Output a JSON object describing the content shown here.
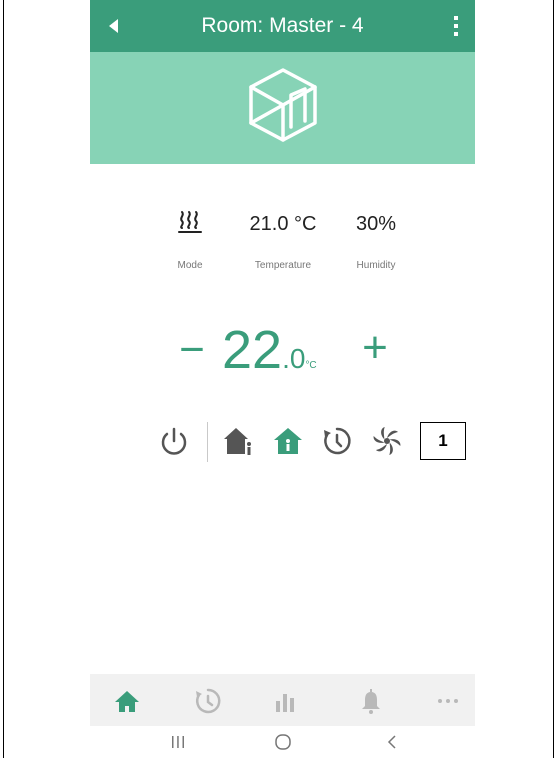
{
  "header": {
    "title": "Room: Master - 4",
    "back_icon": "back-arrow-icon",
    "menu_icon": "kebab-menu-icon",
    "background_color": "#3a9d7b"
  },
  "hero": {
    "icon": "room-icon",
    "background_color": "#87d3b6"
  },
  "status": {
    "mode": {
      "icon": "heating-icon",
      "label": "Mode"
    },
    "temperature": {
      "value": "21.0 °C",
      "label": "Temperature"
    },
    "humidity": {
      "value": "30%",
      "label": "Humidity"
    }
  },
  "setpoint": {
    "minus": "−",
    "plus": "+",
    "integer": "22",
    "decimal": ".0",
    "unit": "°C",
    "color": "#3a9d7b"
  },
  "controls": [
    {
      "icon": "power-icon"
    },
    {
      "icon": "home-info-icon"
    },
    {
      "icon": "home-mode-icon",
      "active": true
    },
    {
      "icon": "schedule-icon"
    },
    {
      "icon": "fan-icon"
    }
  ],
  "callout": {
    "label": "1"
  },
  "bottom_nav": [
    {
      "icon": "home-icon",
      "active": true
    },
    {
      "icon": "clock-icon"
    },
    {
      "icon": "stats-icon"
    },
    {
      "icon": "bell-icon"
    },
    {
      "icon": "more-icon"
    }
  ],
  "system_nav": [
    {
      "icon": "recents-icon",
      "glyph": "|||"
    },
    {
      "icon": "home-button-icon",
      "glyph": "○"
    },
    {
      "icon": "back-icon",
      "glyph": "<"
    }
  ]
}
